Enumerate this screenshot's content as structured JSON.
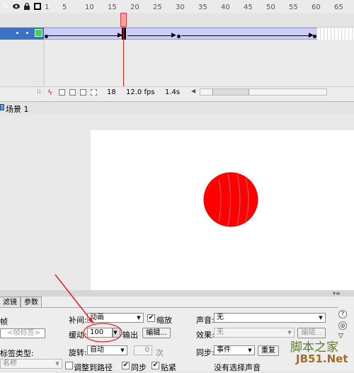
{
  "timeline": {
    "ruler_labels": [
      "1",
      "5",
      "10",
      "15",
      "20",
      "25",
      "30",
      "35",
      "40",
      "45",
      "50",
      "55",
      "60",
      "65"
    ],
    "current_frame": "18",
    "fps": "12.0 fps",
    "time": "1.4s"
  },
  "scene": {
    "label": "场景 1"
  },
  "props": {
    "tabs": [
      "滤镜",
      "参数"
    ],
    "frame_label": "帧",
    "frame_name_placeholder": "<帧标签>",
    "label_type": "标签类型:",
    "label_type_value": "名称",
    "tween_label": "补间:",
    "tween_value": "动画",
    "scale_label": "缩放",
    "ease_label": "缓动:",
    "ease_value": "100",
    "ease_output": "输出",
    "edit_button": "编辑...",
    "rotate_label": "旋转:",
    "rotate_value": "自动",
    "rotate_count": "0",
    "times_label": "次",
    "orient_path": "调整到路径",
    "sync": "同步",
    "snap": "贴紧",
    "sound_label": "声音:",
    "sound_value": "无",
    "effect_label": "效果:",
    "effect_value": "无",
    "effect_edit": "编辑...",
    "sync_label": "同步:",
    "sync_value": "事件",
    "repeat_button": "重复",
    "no_sound": "没有选择声音"
  },
  "watermark": {
    "line1": "脚本之家",
    "line2": "JB51.Net"
  },
  "colors": {
    "ball": "#ff0000",
    "layer_selected": "#3c72c6",
    "tween": "#ccccff",
    "playhead": "#e02020"
  }
}
